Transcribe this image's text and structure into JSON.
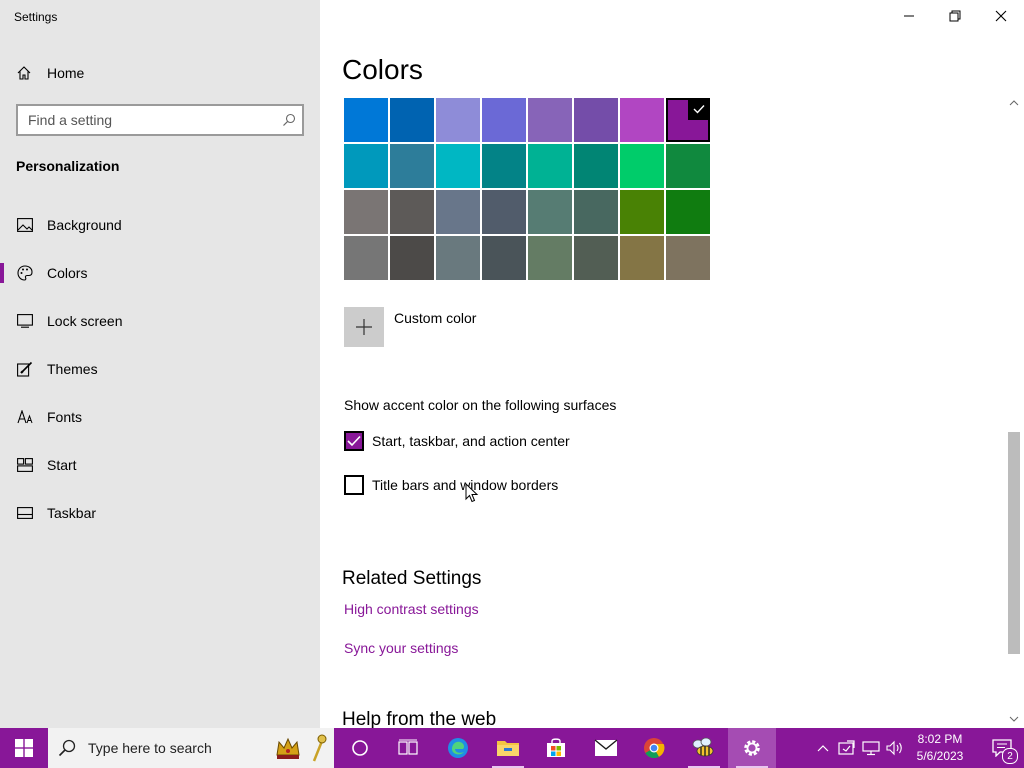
{
  "window": {
    "title": "Settings"
  },
  "nav": {
    "home_label": "Home",
    "search_placeholder": "Find a setting",
    "section_title": "Personalization",
    "items": [
      {
        "label": "Background",
        "icon": "image-icon"
      },
      {
        "label": "Colors",
        "icon": "palette-icon",
        "active": true
      },
      {
        "label": "Lock screen",
        "icon": "lock-screen-icon"
      },
      {
        "label": "Themes",
        "icon": "brush-icon"
      },
      {
        "label": "Fonts",
        "icon": "fonts-icon"
      },
      {
        "label": "Start",
        "icon": "start-icon"
      },
      {
        "label": "Taskbar",
        "icon": "taskbar-icon"
      }
    ]
  },
  "main": {
    "title": "Colors",
    "swatch_colors": [
      "#0078d7",
      "#0063b1",
      "#8e8cd8",
      "#6b69d6",
      "#8764b8",
      "#744da9",
      "#b146c2",
      "#881798",
      "#0099bc",
      "#2d7d9a",
      "#00b7c3",
      "#038387",
      "#00b294",
      "#018574",
      "#00cc6a",
      "#10893e",
      "#7a7574",
      "#5d5a58",
      "#68768a",
      "#515c6b",
      "#567c73",
      "#486860",
      "#498205",
      "#107c10",
      "#767676",
      "#4c4a48",
      "#69797e",
      "#4a5459",
      "#647c64",
      "#525e54",
      "#847545",
      "#7e735f"
    ],
    "selected_swatch": "#881798",
    "custom_color_label": "Custom color",
    "surfaces_heading": "Show accent color on the following surfaces",
    "checkbox_start": {
      "label": "Start, taskbar, and action center",
      "checked": true
    },
    "checkbox_titlebars": {
      "label": "Title bars and window borders",
      "checked": false
    },
    "related_heading": "Related Settings",
    "link_high_contrast": "High contrast settings",
    "link_sync": "Sync your settings",
    "help_heading": "Help from the web"
  },
  "taskbar": {
    "search_placeholder": "Type here to search",
    "accent_color": "#881798",
    "apps": [
      "cortana-icon",
      "task-view-icon",
      "edge-icon",
      "file-explorer-icon",
      "store-icon",
      "mail-icon",
      "chrome-icon",
      "bee-app-icon",
      "settings-icon"
    ],
    "time": "8:02 PM",
    "date": "5/6/2023",
    "notification_count": "2"
  }
}
